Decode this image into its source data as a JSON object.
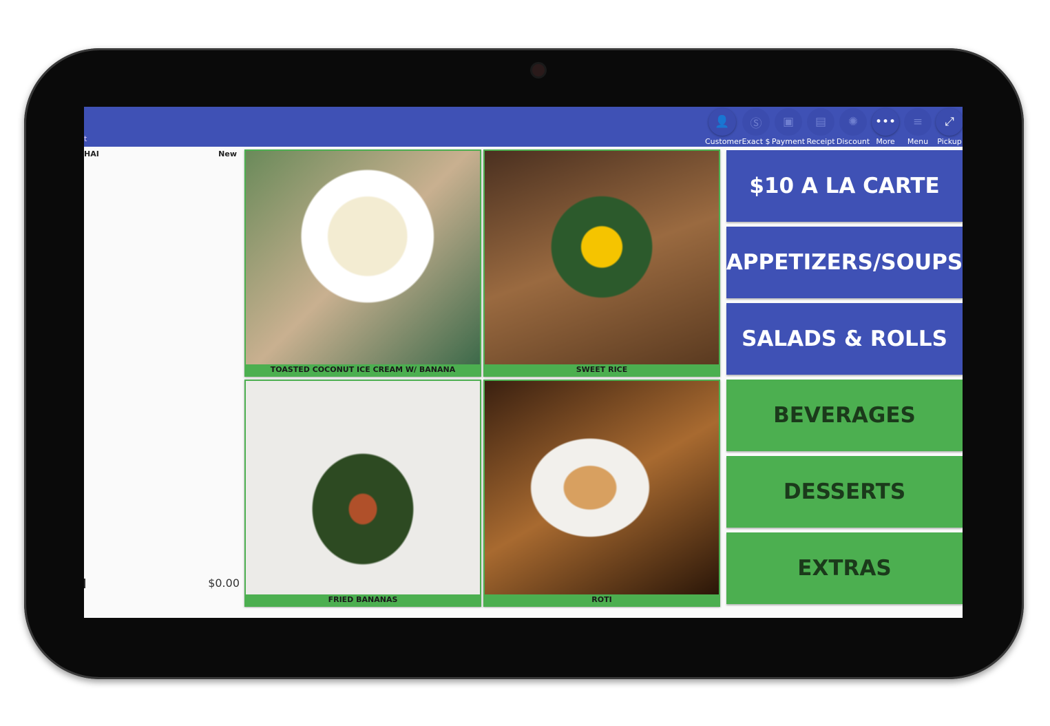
{
  "toolbar": {
    "cut_label": "t",
    "buttons": [
      {
        "label": "Customer",
        "icon": "person-icon",
        "enabled": true
      },
      {
        "label": "Exact $",
        "icon": "dollar-circle-icon",
        "enabled": false
      },
      {
        "label": "Payment",
        "icon": "wallet-icon",
        "enabled": false
      },
      {
        "label": "Receipt",
        "icon": "receipt-icon",
        "enabled": false
      },
      {
        "label": "Discount",
        "icon": "discount-badge-icon",
        "enabled": false
      },
      {
        "label": "More",
        "icon": "more-dots-icon",
        "enabled": true
      },
      {
        "label": "Menu",
        "icon": "hamburger-menu-icon",
        "enabled": false
      },
      {
        "label": "Pickup",
        "icon": "expand-arrows-icon",
        "enabled": true
      }
    ]
  },
  "order": {
    "title": "HAI",
    "status": "New",
    "total": "$0.00"
  },
  "items": [
    {
      "name": "TOASTED COCONUT ICE CREAM W/ BANANA"
    },
    {
      "name": "SWEET RICE"
    },
    {
      "name": "FRIED BANANAS"
    },
    {
      "name": "ROTI"
    }
  ],
  "categories": [
    {
      "label": "$10 A LA CARTE",
      "color": "#3f51b5"
    },
    {
      "label": "APPETIZERS/SOUPS",
      "color": "#3f51b5"
    },
    {
      "label": "SALADS & ROLLS",
      "color": "#3f51b5"
    },
    {
      "label": "BEVERAGES",
      "color": "#4caf50"
    },
    {
      "label": "DESSERTS",
      "color": "#4caf50"
    },
    {
      "label": "EXTRAS",
      "color": "#4caf50"
    }
  ],
  "colors": {
    "primary": "#3f51b5",
    "accent": "#4caf50"
  }
}
